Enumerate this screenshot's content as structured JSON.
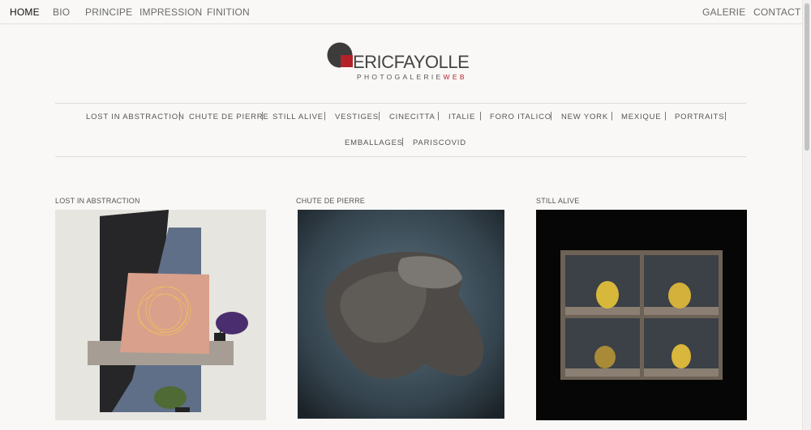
{
  "topnav": {
    "left": [
      {
        "label": "HOME",
        "active": true
      },
      {
        "label": "BIO"
      },
      {
        "label": "PRINCIPE"
      },
      {
        "label": "IMPRESSION"
      },
      {
        "label": "FINITION"
      }
    ],
    "right": [
      {
        "label": "GALERIE"
      },
      {
        "label": "CONTACT"
      }
    ]
  },
  "logo": {
    "name_first": "ERIC",
    "name_last": "FAYOLLE",
    "subtitle": "PHOTOGALERIE",
    "subtitle_accent": "WEB",
    "accent_color": "#b3222a"
  },
  "gallery_menu": {
    "row1": [
      "LOST IN ABSTRACTION",
      "CHUTE DE PIERRE",
      "STILL ALIVE",
      "VESTIGES",
      "CINECITTA",
      "ITALIE",
      "FORO ITALICO",
      "NEW YORK",
      "MEXIQUE",
      "PORTRAITS"
    ],
    "row2": [
      "EMBALLAGES",
      "PARISCOVID"
    ],
    "separator": "|"
  },
  "cards": [
    {
      "title": "LOST IN ABSTRACTION",
      "image": "abstract-collage-umbrellas"
    },
    {
      "title": "CHUTE DE PIERRE",
      "image": "floating-stone-head"
    },
    {
      "title": "STILL ALIVE",
      "image": "quinces-in-wooden-box"
    }
  ]
}
